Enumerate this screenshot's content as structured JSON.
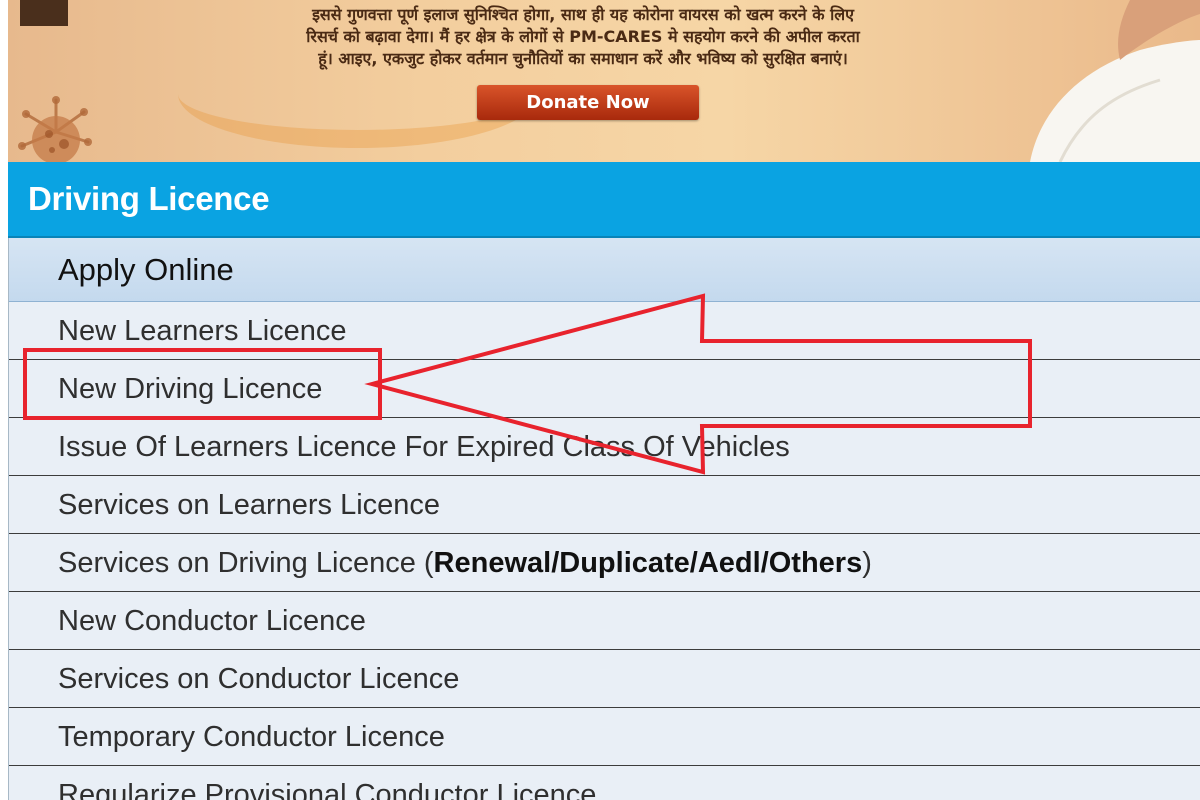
{
  "banner": {
    "hindi_lines": [
      "इससे गुणवत्ता पूर्ण इलाज सुनिश्चित होगा, साथ ही यह कोरोना वायरस को खत्म करने के लिए",
      "रिसर्च को बढ़ावा देगा। मैं हर क्षेत्र के लोगों से PM-CARES मे सहयोग करने की अपील करता",
      "हूं। आइए, एकजुट होकर वर्तमान चुनौतियों का समाधान करें और भविष्य को सुरक्षित बनाएं।"
    ],
    "donate_label": "Donate Now"
  },
  "panel": {
    "title": "Driving Licence",
    "section_label": "Apply Online",
    "items": [
      {
        "label": "New Learners Licence"
      },
      {
        "label": "New Driving Licence"
      },
      {
        "label": "Issue Of Learners Licence For Expired Class Of Vehicles"
      },
      {
        "label": "Services on Learners Licence"
      },
      {
        "label_prefix": "Services on Driving Licence (",
        "label_bold": "Renewal/Duplicate/Aedl/Others",
        "label_suffix": ")"
      },
      {
        "label": "New Conductor Licence"
      },
      {
        "label": "Services on Conductor Licence"
      },
      {
        "label": "Temporary Conductor Licence"
      },
      {
        "label": "Regularize Provisional Conductor Licence"
      }
    ]
  },
  "colors": {
    "header_blue": "#0aa3e2",
    "row_bg": "#e9eff6",
    "annotation_red": "#e8232d",
    "donate_red": "#c2401b"
  },
  "icons": {
    "banner_left": "virus-icon",
    "annotation": "arrow-pointer-icon"
  }
}
